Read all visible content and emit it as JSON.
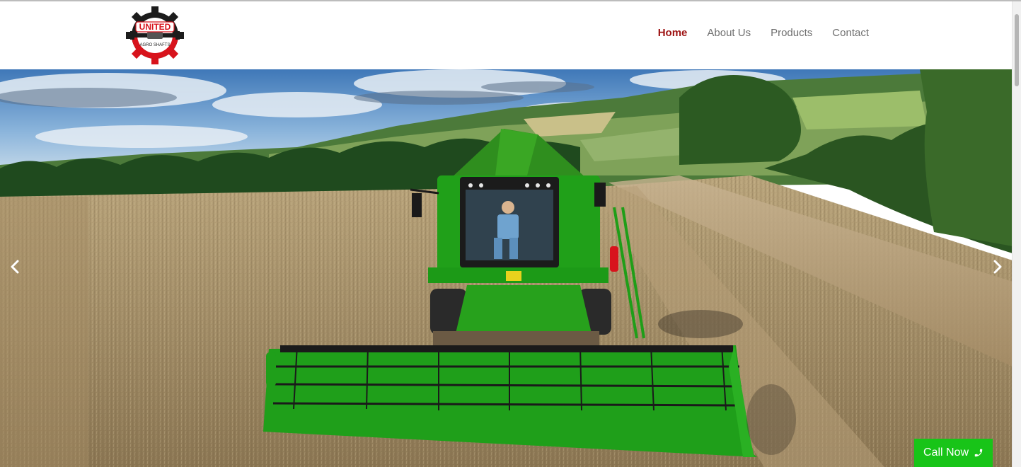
{
  "brand": {
    "logo_text_top": "UNITED",
    "logo_text_bottom": "AGRO SHAFTS"
  },
  "nav": {
    "items": [
      {
        "label": "Home",
        "active": true
      },
      {
        "label": "About Us",
        "active": false
      },
      {
        "label": "Products",
        "active": false
      },
      {
        "label": "Contact",
        "active": false
      }
    ]
  },
  "hero": {
    "prev_icon": "chevron-left-icon",
    "next_icon": "chevron-right-icon"
  },
  "cta": {
    "call_now_label": "Call Now",
    "icon": "phone-icon"
  },
  "colors": {
    "active_nav": "#9d1212",
    "nav_text": "#6f6f6f",
    "call_button": "#18c418",
    "logo_red": "#d8131c",
    "logo_dark": "#1c1c1c"
  }
}
